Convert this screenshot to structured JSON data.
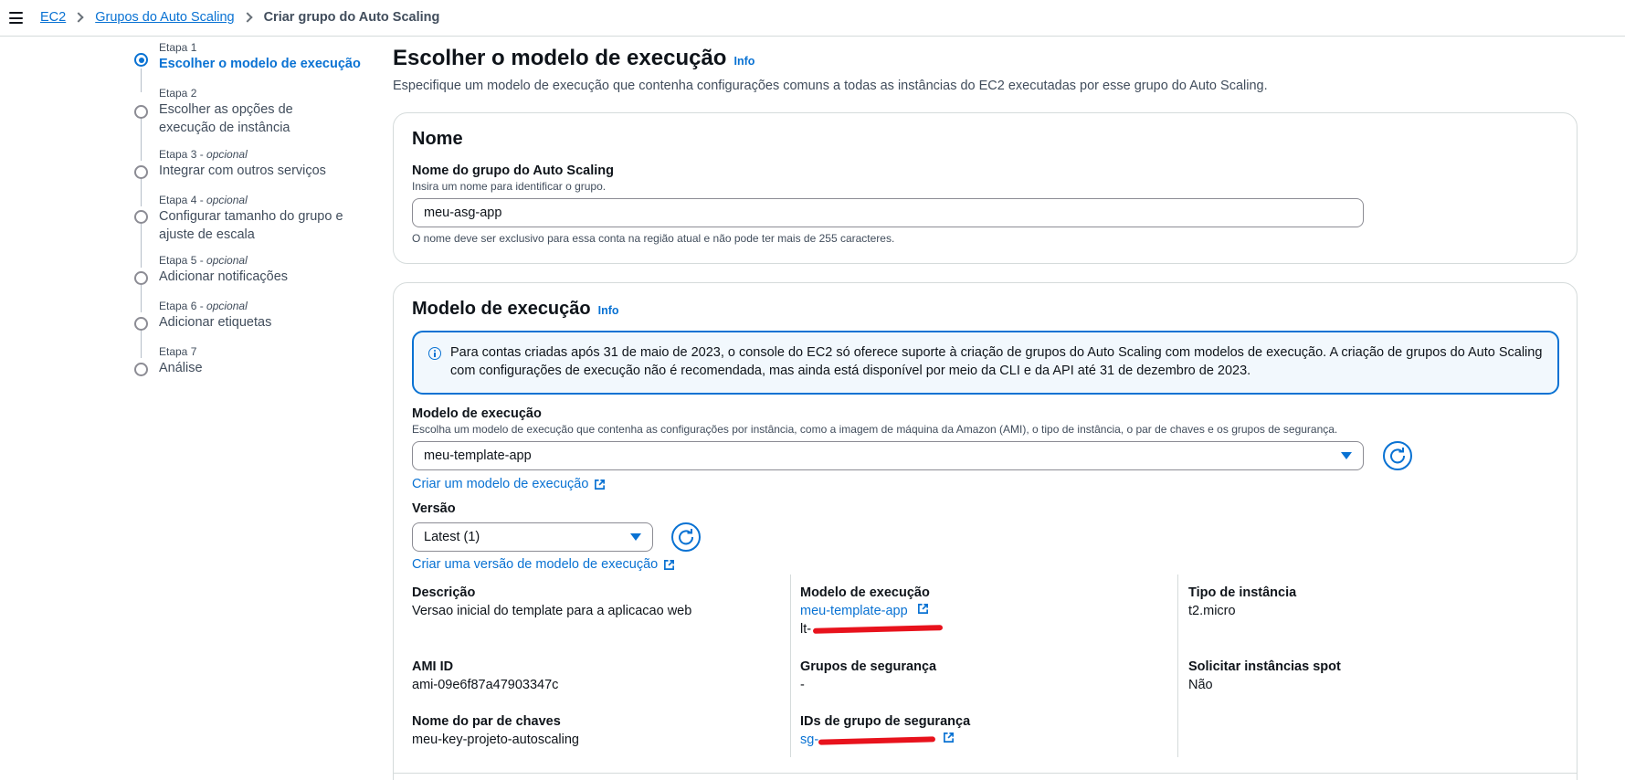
{
  "breadcrumb": {
    "items": [
      "EC2",
      "Grupos do Auto Scaling"
    ],
    "current": "Criar grupo do Auto Scaling"
  },
  "steps": [
    {
      "label": "Etapa 1",
      "optional": "",
      "title": "Escolher o modelo de execução",
      "active": true
    },
    {
      "label": "Etapa 2",
      "optional": "",
      "title": "Escolher as opções de execução de instância"
    },
    {
      "label": "Etapa 3 - ",
      "optional": "opcional",
      "title": "Integrar com outros serviços"
    },
    {
      "label": "Etapa 4 - ",
      "optional": "opcional",
      "title": "Configurar tamanho do grupo e ajuste de escala"
    },
    {
      "label": "Etapa 5 - ",
      "optional": "opcional",
      "title": "Adicionar notificações"
    },
    {
      "label": "Etapa 6 - ",
      "optional": "opcional",
      "title": "Adicionar etiquetas"
    },
    {
      "label": "Etapa 7",
      "optional": "",
      "title": "Análise"
    }
  ],
  "page": {
    "title": "Escolher o modelo de execução",
    "info": "Info",
    "subtitle": "Especifique um modelo de execução que contenha configurações comuns a todas as instâncias do EC2 executadas por esse grupo do Auto Scaling."
  },
  "name_card": {
    "title": "Nome",
    "field_label": "Nome do grupo do Auto Scaling",
    "field_desc": "Insira um nome para identificar o grupo.",
    "value": "meu-asg-app",
    "hint": "O nome deve ser exclusivo para essa conta na região atual e não pode ter mais de 255 caracteres."
  },
  "template_card": {
    "title": "Modelo de execução",
    "info": "Info",
    "alert_line1": "Para contas criadas após 31 de maio de 2023, o console do EC2 só oferece suporte à criação de grupos do Auto Scaling com modelos de execução. A criação de grupos do Auto Scaling",
    "alert_line2": "com configurações de execução não é recomendada, mas ainda está disponível por meio da CLI e da API até 31 de dezembro de 2023.",
    "template_label": "Modelo de execução",
    "template_desc": "Escolha um modelo de execução que contenha as configurações por instância, como a imagem de máquina da Amazon (AMI), o tipo de instância, o par de chaves e os grupos de segurança.",
    "template_value": "meu-template-app",
    "create_template_link": "Criar um modelo de execução",
    "version_label": "Versão",
    "version_value": "Latest (1)",
    "create_version_link": "Criar uma versão de modelo de execução",
    "details": {
      "descricao_label": "Descrição",
      "descricao_value": "Versao inicial do template para a aplicacao web",
      "modelo_label": "Modelo de execução",
      "modelo_link": "meu-template-app",
      "modelo_id": "lt-",
      "tipo_label": "Tipo de instância",
      "tipo_value": "t2.micro",
      "ami_label": "AMI ID",
      "ami_value": "ami-09e6f87a47903347c",
      "grupos_label": "Grupos de segurança",
      "grupos_value": "-",
      "spot_label": "Solicitar instâncias spot",
      "spot_value": "Não",
      "chave_label": "Nome do par de chaves",
      "chave_value": "meu-key-projeto-autoscaling",
      "ids_label": "IDs de grupo de segurança",
      "ids_value": "sg-"
    }
  },
  "colors": {
    "accent": "#0972d3",
    "redaction": "#e8121c"
  }
}
